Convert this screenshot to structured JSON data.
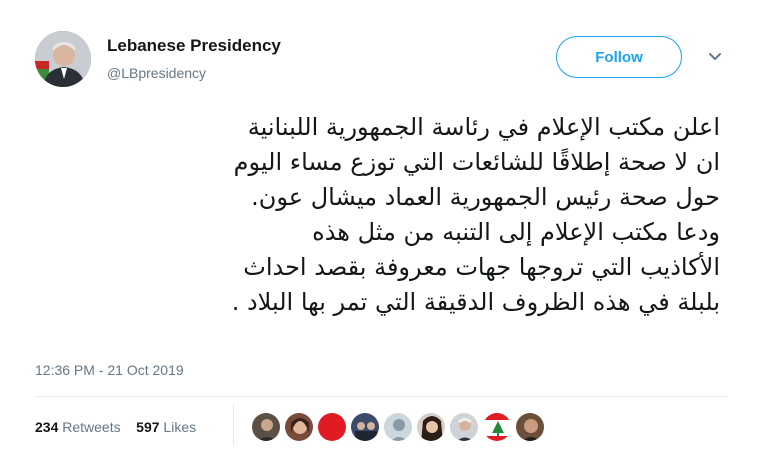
{
  "author": {
    "name": "Lebanese Presidency",
    "handle": "@LBpresidency"
  },
  "follow_button": {
    "label": "Follow"
  },
  "tweet": {
    "lines": [
      "اعلن مكتب الإعلام في رئاسة الجمهورية اللبنانية",
      "ان لا صحة إطلاقًا للشائعات التي توزع مساء اليوم",
      "حول صحة رئيس الجمهورية العماد ميشال عون.",
      "ودعا مكتب الإعلام إلى التنبه من مثل هذه",
      "الأكاذيب التي تروجها جهات معروفة بقصد احداث",
      "بلبلة في هذه الظروف الدقيقة التي تمر بها البلاد ."
    ],
    "timestamp": "12:36 PM - 21 Oct 2019"
  },
  "stats": {
    "retweets_count": "234",
    "retweets_label": "Retweets",
    "likes_count": "597",
    "likes_label": "Likes"
  },
  "colors": {
    "accent": "#1da1f2",
    "secondary_text": "#657786",
    "divider": "#e6ecf0"
  },
  "icons": {
    "menu": "chevron-down-icon"
  }
}
